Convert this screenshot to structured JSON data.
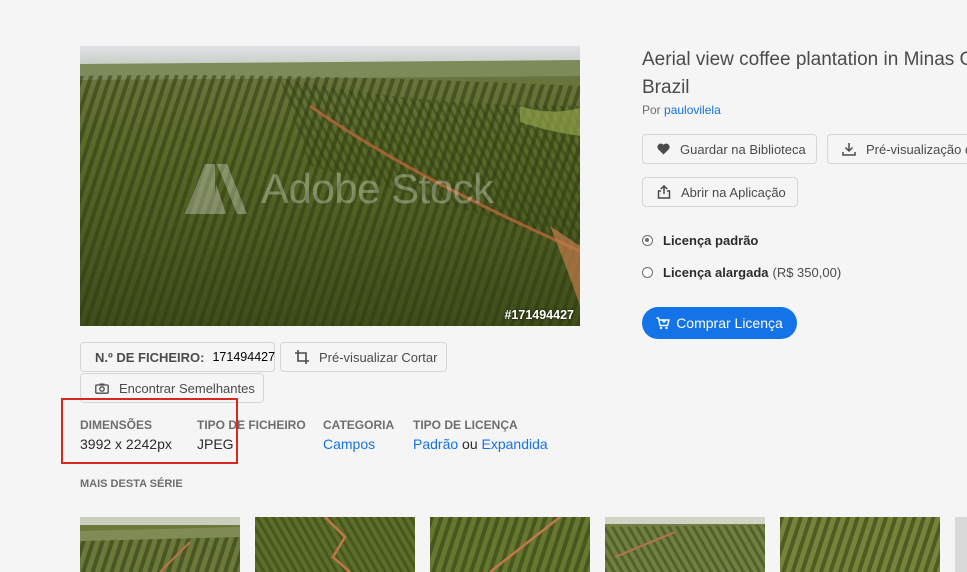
{
  "image": {
    "watermark": "Adobe Stock",
    "asset_id_label": "#171494427"
  },
  "actions": {
    "file_number_label": "N.º DE FICHEIRO:",
    "file_number_value": "171494427",
    "preview_crop": "Pré-visualizar Cortar",
    "find_similar": "Encontrar Semelhantes"
  },
  "info": {
    "dimensions_label": "DIMENSÕES",
    "dimensions_value": "3992 x 2242px",
    "file_type_label": "TIPO DE FICHEIRO",
    "file_type_value": "JPEG",
    "category_label": "CATEGORIA",
    "category_value": "Campos",
    "license_type_label": "TIPO DE LICENÇA",
    "license_standard": "Padrão",
    "license_or": "ou",
    "license_extended": "Expandida"
  },
  "series": {
    "title": "MAIS DESTA SÉRIE"
  },
  "detail": {
    "title_line1": "Aerial view coffee plantation in Minas G",
    "title_line2": "Brazil",
    "by_prefix": "Por",
    "author": "paulovilela",
    "save_library": "Guardar na Biblioteca",
    "preview_download": "Pré-visualização d",
    "open_in_app": "Abrir na Aplicação",
    "license_standard": "Licença padrão",
    "license_extended": "Licença alargada",
    "license_extended_price": "(R$ 350,00)",
    "buy_button": "Comprar Licença"
  },
  "colors": {
    "accent": "#1473e6",
    "highlight": "#d7281f",
    "background": "#f5f5f5"
  }
}
